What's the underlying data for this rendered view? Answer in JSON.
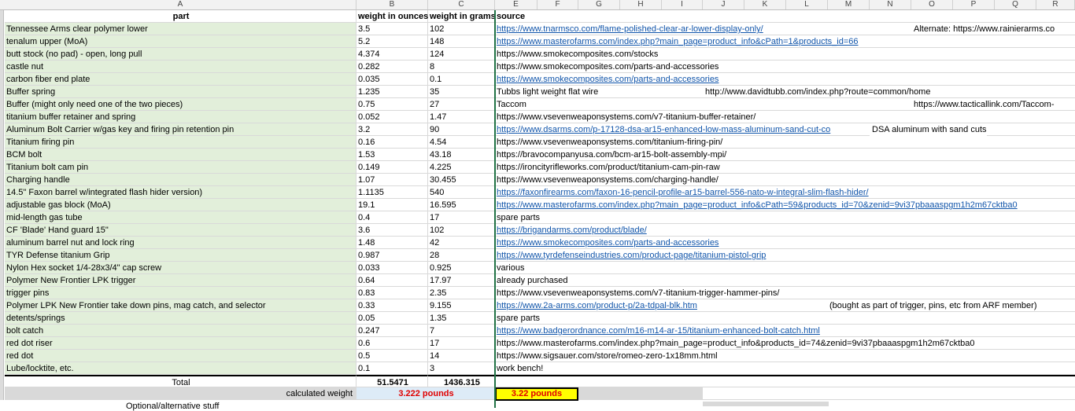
{
  "columns": [
    "A",
    "B",
    "C",
    "E",
    "F",
    "G",
    "H",
    "I",
    "J",
    "K",
    "L",
    "M",
    "N",
    "O",
    "P",
    "Q",
    "R"
  ],
  "headers": {
    "part": "part",
    "ounces": "weight in ounces",
    "grams": "weight in grams",
    "source": "source"
  },
  "rows": [
    {
      "part": "Tennessee Arms clear polymer lower",
      "oz": "3.5",
      "g": "102",
      "src": "https://www.tnarmsco.com/flame-polished-clear-ar-lower-display-only/",
      "link": true,
      "extra": "Alternate: https://www.rainierarms.co"
    },
    {
      "part": "tenalum upper (MoA)",
      "oz": "5.2",
      "g": "148",
      "src": "https://www.masterofarms.com/index.php?main_page=product_info&cPath=1&products_id=66",
      "link": true
    },
    {
      "part": "butt stock (no pad) - open, long pull",
      "oz": "4.374",
      "g": "124",
      "src": "https://www.smokecomposites.com/stocks",
      "link": false
    },
    {
      "part": "castle nut",
      "oz": "0.282",
      "g": "8",
      "src": "https://www.smokecomposites.com/parts-and-accessories",
      "link": false
    },
    {
      "part": "carbon fiber end plate",
      "oz": "0.035",
      "g": "0.1",
      "src": "https://www.smokecomposites.com/parts-and-accessories",
      "link": true
    },
    {
      "part": "Buffer spring",
      "oz": "1.235",
      "g": "35",
      "src": "Tubbs light weight flat wire",
      "link": false,
      "extra2": "http://www.davidtubb.com/index.php?route=common/home"
    },
    {
      "part": "Buffer (might only need one of the two pieces)",
      "oz": "0.75",
      "g": "27",
      "src": "Taccom",
      "link": false,
      "extra": "https://www.tacticallink.com/Taccom-"
    },
    {
      "part": "titanium buffer retainer and spring",
      "oz": "0.052",
      "g": "1.47",
      "src": "https://www.vsevenweaponsystems.com/v7-titanium-buffer-retainer/",
      "link": false
    },
    {
      "part": "Aluminum Bolt Carrier w/gas key and firing pin retention pin",
      "oz": "3.2",
      "g": "90",
      "src": "https://www.dsarms.com/p-17128-dsa-ar15-enhanced-low-mass-aluminum-sand-cut-co",
      "link": true,
      "extra3": "DSA aluminum with sand cuts"
    },
    {
      "part": "Titanium firing pin",
      "oz": "0.16",
      "g": "4.54",
      "src": "https://www.vsevenweaponsystems.com/titanium-firing-pin/",
      "link": false
    },
    {
      "part": "BCM bolt",
      "oz": "1.53",
      "g": "43.18",
      "src": "https://bravocompanyusa.com/bcm-ar15-bolt-assembly-mpi/",
      "link": false
    },
    {
      "part": "Titanium bolt cam pin",
      "oz": "0.149",
      "g": "4.225",
      "src": "https://ironcityrifleworks.com/product/titanium-cam-pin-raw",
      "link": false
    },
    {
      "part": "Charging handle",
      "oz": "1.07",
      "g": "30.455",
      "src": "https://www.vsevenweaponsystems.com/charging-handle/",
      "link": false
    },
    {
      "part": "14.5\" Faxon barrel w/integrated flash hider version)",
      "oz": "1.1135",
      "g": "540",
      "src": "https://faxonfirearms.com/faxon-16-pencil-profile-ar15-barrel-556-nato-w-integral-slim-flash-hider/",
      "link": true
    },
    {
      "part": "adjustable gas block (MoA)",
      "oz": "19.1",
      "g": "16.595",
      "src": "https://www.masterofarms.com/index.php?main_page=product_info&cPath=59&products_id=70&zenid=9vi37pbaaaspgm1h2m67cktba0",
      "link": true
    },
    {
      "part": "mid-length gas tube",
      "oz": "0.4",
      "g": "17",
      "src": "spare parts",
      "link": false
    },
    {
      "part": "CF 'Blade' Hand guard 15\"",
      "oz": "3.6",
      "g": "102",
      "src": "https://brigandarms.com/product/blade/",
      "link": true
    },
    {
      "part": "aluminum barrel nut and lock ring",
      "oz": "1.48",
      "g": "42",
      "src": "https://www.smokecomposites.com/parts-and-accessories",
      "link": true
    },
    {
      "part": "TYR Defense titanium Grip",
      "oz": "0.987",
      "g": "28",
      "src": "https://www.tyrdefenseindustries.com/product-page/titanium-pistol-grip",
      "link": true
    },
    {
      "part": "Nylon Hex socket 1/4-28x3/4\" cap screw",
      "oz": "0.033",
      "g": "0.925",
      "src": "various",
      "link": false
    },
    {
      "part": "Polymer New Frontier LPK trigger",
      "oz": "0.64",
      "g": "17.97",
      "src": "already purchased",
      "link": false
    },
    {
      "part": "trigger pins",
      "oz": "0.83",
      "g": "2.35",
      "src": "https://www.vsevenweaponsystems.com/v7-titanium-trigger-hammer-pins/",
      "link": false
    },
    {
      "part": "Polymer LPK New Frontier take down pins, mag catch, and selector",
      "oz": "0.33",
      "g": "9.155",
      "src": "https://www.2a-arms.com/product-p/2a-tdpal-blk.htm",
      "link": true,
      "extra4": "(bought as part of trigger, pins, etc from ARF member)"
    },
    {
      "part": "detents/springs",
      "oz": "0.05",
      "g": "1.35",
      "src": "spare parts",
      "link": false
    },
    {
      "part": "bolt catch",
      "oz": "0.247",
      "g": "7",
      "src": "https://www.badgerordnance.com/m16-m14-ar-15/titanium-enhanced-bolt-catch.html",
      "link": true
    },
    {
      "part": "red dot riser",
      "oz": "0.6",
      "g": "17",
      "src": "https://www.masterofarms.com/index.php?main_page=product_info&products_id=74&zenid=9vi37pbaaaspgm1h2m67cktba0",
      "link": false
    },
    {
      "part": "red dot",
      "oz": "0.5",
      "g": "14",
      "src": "https://www.sigsauer.com/store/romeo-zero-1x18mm.html",
      "link": false
    },
    {
      "part": "Lube/locktite, etc.",
      "oz": "0.1",
      "g": "3",
      "src": "work bench!",
      "link": false
    }
  ],
  "total": {
    "label": "Total",
    "oz": "51.5471",
    "g": "1436.315"
  },
  "calc": {
    "label": "calculated weight",
    "oz": "3.222  pounds",
    "src": "3.22  pounds"
  },
  "partial_text": "Optional/alternative stuff"
}
